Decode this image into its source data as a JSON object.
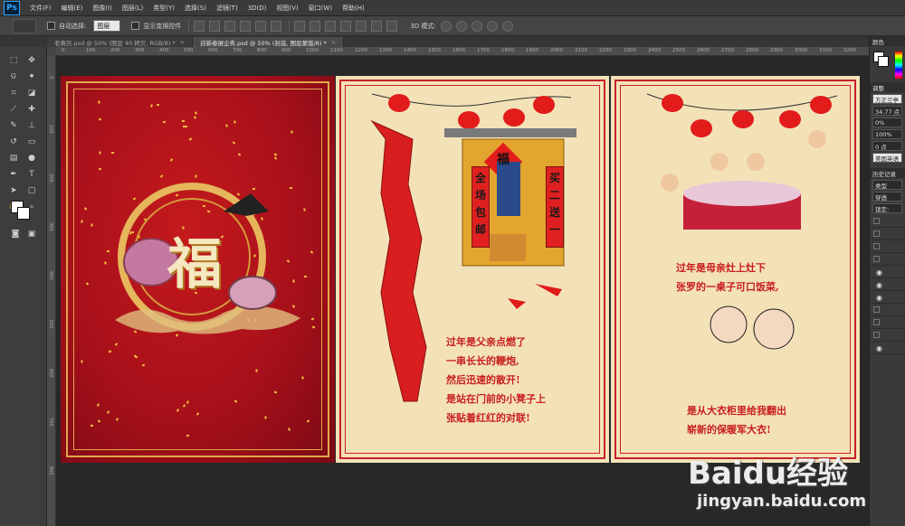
{
  "app": {
    "logo": "Ps"
  },
  "menu": [
    "文件(F)",
    "编辑(E)",
    "图像(I)",
    "图层(L)",
    "类型(Y)",
    "选择(S)",
    "滤镜(T)",
    "3D(D)",
    "视图(V)",
    "窗口(W)",
    "帮助(H)"
  ],
  "options": {
    "auto_select_label": "自动选择:",
    "auto_select_value": "图层",
    "show_transform_label": "显示变换控件",
    "mode_3d_label": "3D 模式:"
  },
  "tabs": [
    {
      "label": "老黄历.psd @ 50% (图层 40 拷贝, RGB/8) *",
      "active": false
    },
    {
      "label": "迎新春展企秀.psd @ 50% (封底, 图层蒙版/8) *",
      "active": true
    }
  ],
  "ruler_ticks": [
    "0",
    "100",
    "200",
    "300",
    "400",
    "500",
    "600",
    "700",
    "800",
    "900",
    "1000",
    "1100",
    "1200",
    "1300",
    "1400",
    "1500",
    "1600",
    "1700",
    "1800",
    "1900",
    "2000",
    "2100",
    "2200",
    "2300",
    "2400",
    "2500",
    "2600",
    "2700",
    "2800",
    "2900",
    "3000",
    "3100",
    "3200"
  ],
  "ruler_left_ticks": [
    "0",
    "100",
    "200",
    "300",
    "400",
    "500",
    "600",
    "700",
    "800"
  ],
  "panel1": {
    "character": "福"
  },
  "panel2": {
    "door_sign": "福",
    "couplet_left": "全场包邮",
    "couplet_right": "买二送一",
    "poem": [
      "过年是父亲点燃了",
      "一串长长的鞭炮,",
      "然后迅速的散开!",
      "是站在门前的小凳子上",
      "张贴着红红的对联!"
    ]
  },
  "panel3": {
    "poem_top": [
      "过年是母亲灶上灶下",
      "张罗的一桌子可口饭菜,"
    ],
    "poem_bottom": [
      "是从大衣柜里给我翻出",
      "崭新的保暖军大衣!"
    ]
  },
  "right_panels": {
    "color_tab": "颜色",
    "adjust_tab": "调整",
    "font": "方正兰亭",
    "size": "34.77 点",
    "tracking": "0%",
    "scale": "100%",
    "baseline": "0 点",
    "lang": "美国英语",
    "history_tab": "历史记录",
    "kind": "类型",
    "filter": "穿透",
    "lock": "锁定:"
  },
  "watermark": {
    "brand": "Baidu经验",
    "url": "jingyan.baidu.com"
  }
}
